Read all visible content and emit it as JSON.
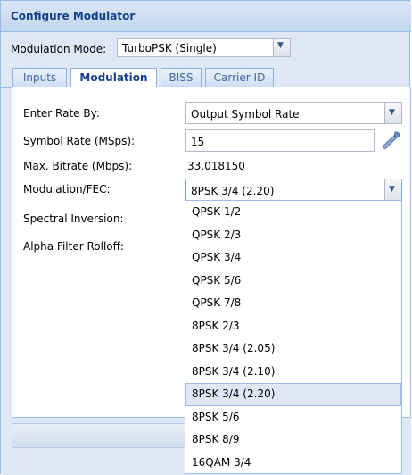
{
  "window": {
    "title": "Configure Modulator"
  },
  "mode": {
    "label": "Modulation Mode:",
    "value": "TurboPSK (Single)"
  },
  "tabs": [
    {
      "label": "Inputs",
      "active": false
    },
    {
      "label": "Modulation",
      "active": true
    },
    {
      "label": "BISS",
      "active": false
    },
    {
      "label": "Carrier ID",
      "active": false
    }
  ],
  "form": {
    "enter_rate_label": "Enter Rate By:",
    "enter_rate_value": "Output Symbol Rate",
    "symbol_rate_label": "Symbol Rate (MSps):",
    "symbol_rate_value": "15",
    "max_bitrate_label": "Max. Bitrate (Mbps):",
    "max_bitrate_value": "33.018150",
    "modfec_label": "Modulation/FEC:",
    "modfec_value": "8PSK 3/4 (2.20)",
    "spectral_label": "Spectral Inversion:",
    "alpha_label": "Alpha Filter Rolloff:"
  },
  "dropdown": {
    "options": [
      "QPSK 1/2",
      "QPSK 2/3",
      "QPSK 3/4",
      "QPSK 5/6",
      "QPSK 7/8",
      "8PSK 2/3",
      "8PSK 3/4 (2.05)",
      "8PSK 3/4 (2.10)",
      "8PSK 3/4 (2.20)",
      "8PSK 5/6",
      "8PSK 8/9",
      "16QAM 3/4"
    ],
    "selected_index": 8
  },
  "icons": {
    "trigger": "chevron-down-icon",
    "calculator": "wrench-icon"
  },
  "colors": {
    "title_text": "#15428b",
    "panel_border": "#99bbe8",
    "panel_bg": "#dfe8f6",
    "selected_bg": "#dfe8f6"
  }
}
